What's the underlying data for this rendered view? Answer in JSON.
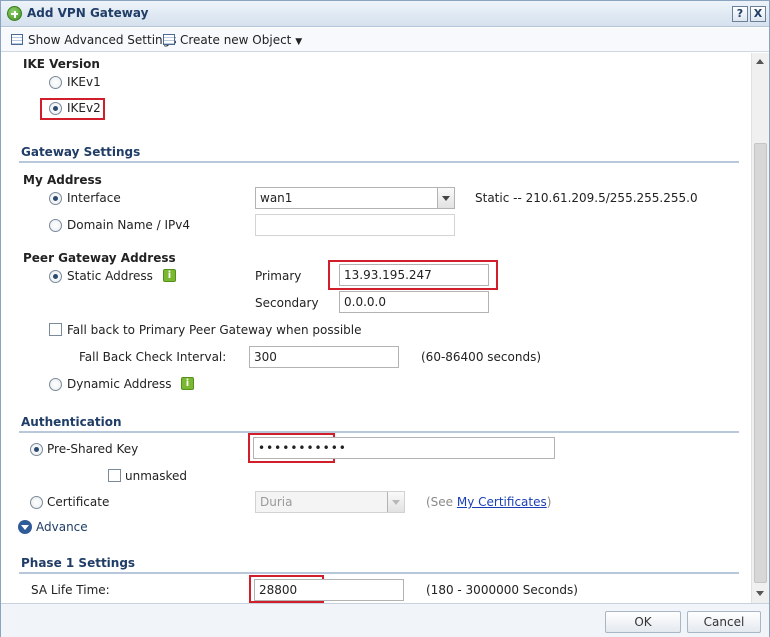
{
  "window": {
    "title": "Add VPN Gateway",
    "help_label": "?",
    "close_label": "X"
  },
  "toolbar": {
    "show_advanced": "Show Advanced Settings",
    "create_object": "Create new Object"
  },
  "ike": {
    "title": "IKE Version",
    "options": [
      {
        "label": "IKEv1",
        "selected": false
      },
      {
        "label": "IKEv2",
        "selected": true
      }
    ]
  },
  "gateway": {
    "section": "Gateway Settings"
  },
  "my_address": {
    "title": "My Address",
    "interface_label": "Interface",
    "interface_value": "wan1",
    "interface_info": "Static -- 210.61.209.5/255.255.255.0",
    "domain_label": "Domain Name / IPv4",
    "domain_value": ""
  },
  "peer": {
    "title": "Peer Gateway Address",
    "static_label": "Static Address",
    "primary_label": "Primary",
    "primary_value": "13.93.195.247",
    "secondary_label": "Secondary",
    "secondary_value": "0.0.0.0",
    "fallback_label": "Fall back to Primary Peer Gateway when possible",
    "interval_label": "Fall Back Check Interval:",
    "interval_value": "300",
    "interval_hint": "(60-86400 seconds)",
    "dynamic_label": "Dynamic Address",
    "info_glyph": "i"
  },
  "auth": {
    "section": "Authentication",
    "psk_label": "Pre-Shared Key",
    "psk_value": "•••••••••••",
    "unmasked_label": "unmasked",
    "cert_label": "Certificate",
    "cert_value": "Duria",
    "cert_hint_prefix": "(See ",
    "cert_link": "My Certificates",
    "cert_hint_suffix": ")",
    "advance_label": "Advance"
  },
  "phase1": {
    "section": "Phase 1 Settings",
    "sa_label": "SA Life Time:",
    "sa_value": "28800",
    "sa_hint": "(180 - 3000000 Seconds)"
  },
  "footer": {
    "ok": "OK",
    "cancel": "Cancel"
  },
  "colors": {
    "highlight": "#d01f2b",
    "section_title": "#1f3d66",
    "link": "#1a3fb5"
  }
}
